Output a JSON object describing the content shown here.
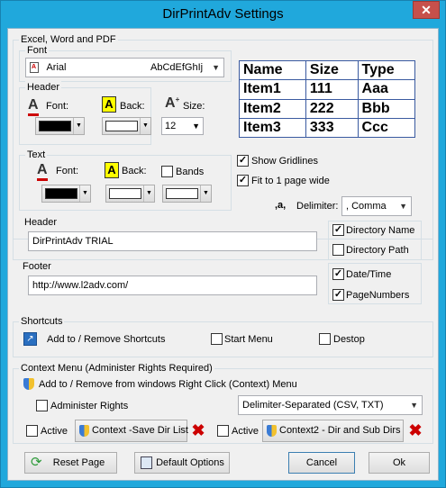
{
  "window": {
    "title": "DirPrintAdv Settings",
    "close": "✕"
  },
  "excel": {
    "label": "Excel, Word and PDF",
    "font": {
      "label": "Font",
      "name": "Arial",
      "sample": "AbCdEfGhIj"
    },
    "header": {
      "label": "Header",
      "font_label": "Font:",
      "back_label": "Back:",
      "size_label": "Size:",
      "size": "12",
      "font_color": "#000000",
      "back_color": "#ffffff"
    },
    "text": {
      "label": "Text",
      "font_label": "Font:",
      "back_label": "Back:",
      "bands_label": "Bands",
      "font_color": "#000000",
      "back_color": "#ffffff",
      "bands_color": "#ffffff"
    },
    "preview": {
      "headers": [
        "Name",
        "Size",
        "Type"
      ],
      "rows": [
        [
          "Item1",
          "111",
          "Aaa"
        ],
        [
          "Item2",
          "222",
          "Bbb"
        ],
        [
          "Item3",
          "333",
          "Ccc"
        ]
      ]
    },
    "show_gridlines": "Show Gridlines",
    "fit_page": "Fit to 1 page wide",
    "delimiter_icon": ",a,",
    "delimiter_label": "Delimiter:",
    "delimiter_value": ", Comma"
  },
  "header_section": {
    "label": "Header",
    "value": "DirPrintAdv TRIAL",
    "directory_name": "Directory Name",
    "directory_path": "Directory Path"
  },
  "footer_section": {
    "label": "Footer",
    "value": "http://www.l2adv.com/",
    "date_time": "Date/Time",
    "page_numbers": "PageNumbers"
  },
  "shortcuts": {
    "label": "Shortcuts",
    "add_remove": "Add to / Remove Shortcuts",
    "start_menu": "Start Menu",
    "desktop": "Destop"
  },
  "context": {
    "label": "Context Menu (Administer Rights Required)",
    "add_remove": "Add to / Remove from windows Right Click (Context) Menu",
    "admin_rights": "Administer Rights",
    "format": "Delimiter-Separated (CSV, TXT)",
    "active1": "Active",
    "ctx1": "Context -Save Dir List",
    "active2": "Active",
    "ctx2": "Context2 - Dir and Sub Dirs"
  },
  "buttons": {
    "reset": "Reset Page",
    "defaults": "Default Options",
    "cancel": "Cancel",
    "ok": "Ok"
  },
  "colors": {
    "titlebar": "#20a8dc",
    "accent_red": "#c00000",
    "highlight_yellow": "#ffff00"
  }
}
